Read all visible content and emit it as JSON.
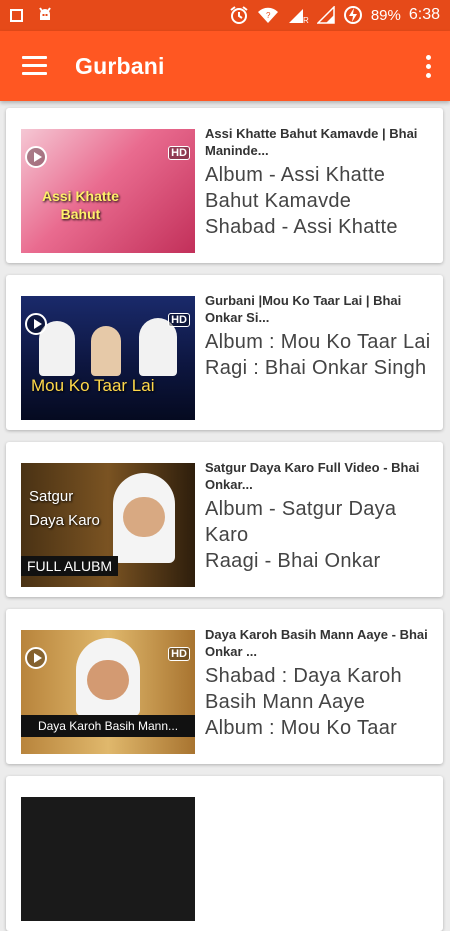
{
  "status_bar": {
    "battery": "89%",
    "time": "6:38"
  },
  "app_bar": {
    "title": "Gurbani"
  },
  "items": [
    {
      "title": "Assi Khatte Bahut Kamavde | Bhai Maninde...",
      "line1": "Album - Assi Khatte Bahut Kamavde",
      "line2": "Shabad - Assi Khatte",
      "thumb_text": "Assi Khatte Bahut"
    },
    {
      "title": "Gurbani |Mou Ko Taar Lai | Bhai Onkar Si...",
      "line1": "Album :  Mou Ko Taar Lai",
      "line2": "Ragi : Bhai Onkar Singh",
      "thumb_text": "Mou Ko Taar Lai"
    },
    {
      "title": "Satgur Daya Karo Full Video - Bhai Onkar...",
      "line1": "Album - Satgur Daya Karo",
      "line2": "Raagi - Bhai Onkar",
      "thumb_text": "Satgur Daya Karo",
      "thumb_badge": "FULL ALUBM"
    },
    {
      "title": "Daya Karoh Basih Mann Aaye - Bhai Onkar ...",
      "line1": "Shabad : Daya Karoh Basih Mann Aaye",
      "line2": "Album : Mou Ko Taar",
      "thumb_text": "Daya Karoh Basih Mann..."
    }
  ],
  "thumb_hd": "HD",
  "colors": {
    "status_bar": "#e64a19",
    "app_bar": "#ff5722",
    "background": "#ececec"
  }
}
